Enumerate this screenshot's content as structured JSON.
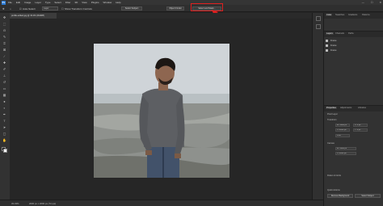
{
  "app": {
    "logo": "Ps"
  },
  "menu": [
    "File",
    "Edit",
    "Image",
    "Layer",
    "Type",
    "Select",
    "Filter",
    "3D",
    "View",
    "Plugins",
    "Window",
    "Help"
  ],
  "window_controls": [
    "—",
    "☐",
    "✕"
  ],
  "options": {
    "auto_select": "Auto-Select:",
    "layer_dropdown": "Layer",
    "show_transform": "Show Transform Controls",
    "select_subject": "Select Subject",
    "object_finder": "Object Finder",
    "refine": "Select and Mask..."
  },
  "document": {
    "tab": "profile-edited.jpg @ 33.3% (RGB/8)"
  },
  "status": {
    "zoom": "33.33%",
    "info": "2000 px x 2000 px (72 ppi)"
  },
  "panels": {
    "top_tabs": [
      "Color",
      "Swatches",
      "Gradients",
      "Patterns"
    ],
    "layers_tabs": [
      "Layers",
      "Channels",
      "Paths"
    ],
    "layers": [
      "Frame",
      "Frame",
      "Frame"
    ],
    "props_tabs": [
      "Properties",
      "Adjustments",
      "Libraries"
    ],
    "props": {
      "section": "Pixel Layer",
      "transform": "Transform",
      "w": "W: 2000 px",
      "h": "H: 2000 px",
      "x": "X: 0 px",
      "y": "Y: 0 px",
      "angle": "0.00°",
      "canvas": "Canvas",
      "rulers": "Rulers & Grids",
      "quick_actions": "Quick Actions",
      "remove_bg": "Remove Background",
      "select_subject": "Select Subject"
    }
  },
  "colors": {
    "highlight": "#e02020",
    "fg": "#111111",
    "bg": "#ffffff"
  }
}
